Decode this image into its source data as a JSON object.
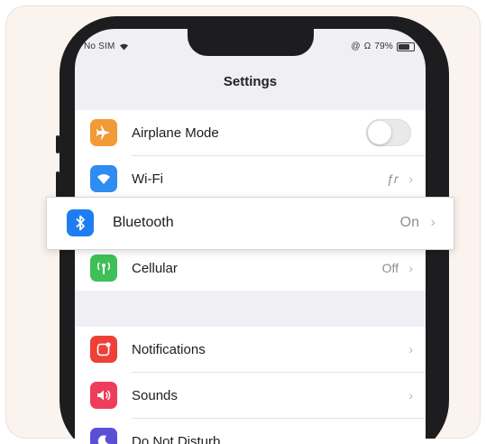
{
  "status_bar": {
    "carrier": "No SIM",
    "battery_text": "79%",
    "right_icons": [
      "@",
      "Ω"
    ]
  },
  "header": {
    "title": "Settings"
  },
  "group_connectivity": [
    {
      "label": "Airplane Mode",
      "icon": "airplane-icon",
      "color": "#f19a37",
      "accessory": "toggle",
      "toggle_on": false
    },
    {
      "label": "Wi-Fi",
      "icon": "wifi-icon",
      "color": "#2f8cf0",
      "value": "ƒ𝑟",
      "accessory": "chevron"
    },
    {
      "label": "Bluetooth",
      "icon": "bluetooth-icon",
      "color": "#1f7df2",
      "value": "On",
      "accessory": "chevron",
      "highlighted": true
    },
    {
      "label": "Cellular",
      "icon": "cellular-icon",
      "color": "#3ebf57",
      "value": "Off",
      "accessory": "chevron"
    }
  ],
  "group_notifications": [
    {
      "label": "Notifications",
      "icon": "notifications-icon",
      "color": "#ee4037",
      "accessory": "chevron"
    },
    {
      "label": "Sounds",
      "icon": "sounds-icon",
      "color": "#ee3d5a",
      "accessory": "chevron"
    },
    {
      "label": "Do Not Disturb",
      "icon": "moon-icon",
      "color": "#5b4fd6",
      "accessory": "chevron"
    }
  ],
  "chevron": "›"
}
